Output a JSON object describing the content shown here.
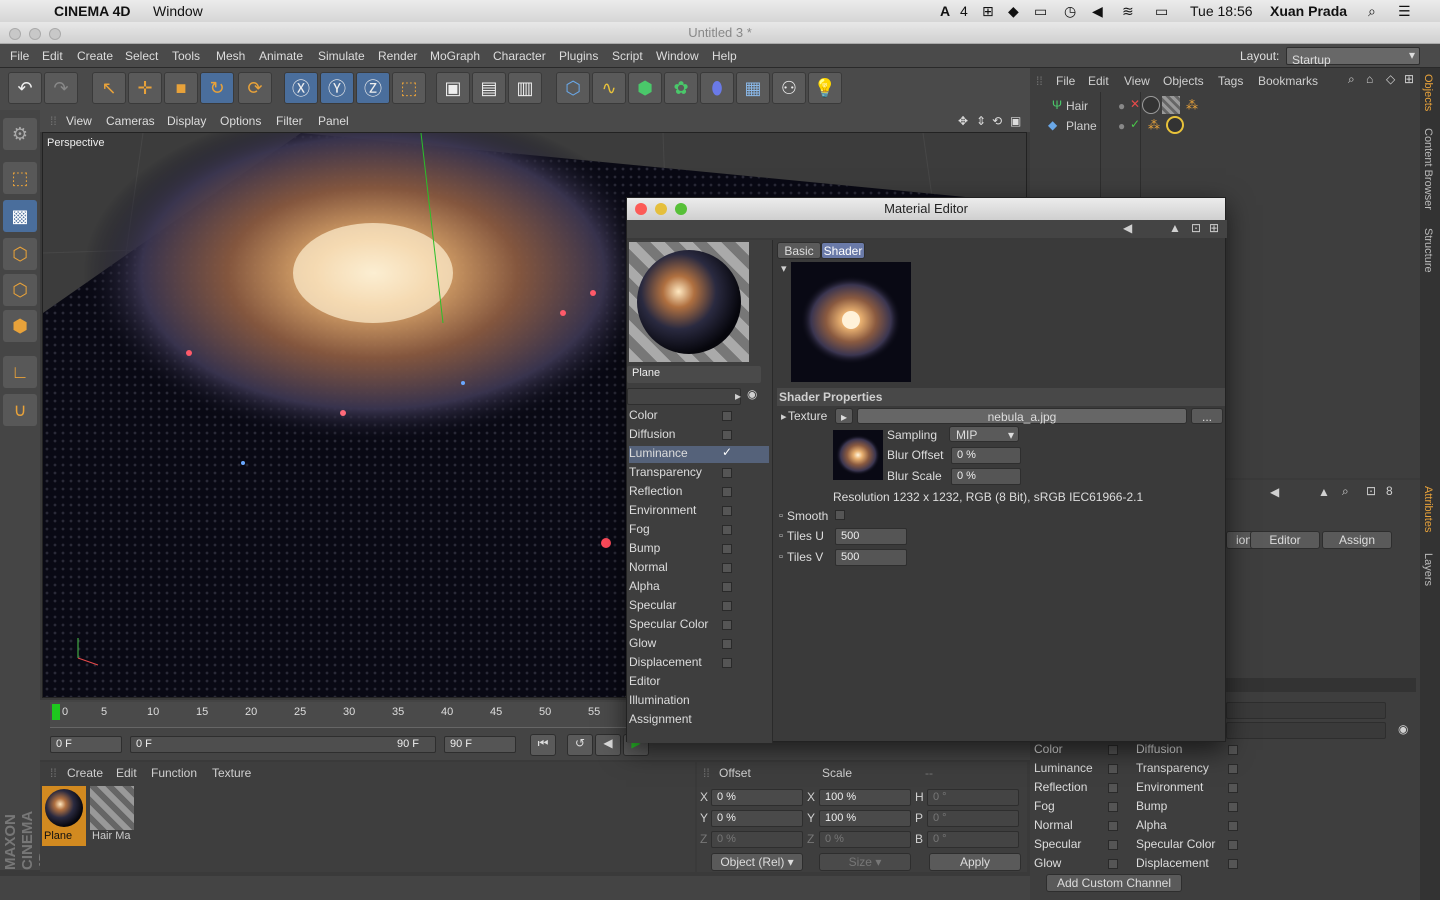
{
  "mac": {
    "app": "CINEMA 4D",
    "menu_window": "Window",
    "battery_num": "4",
    "clock": "Tue 18:56",
    "user": "Xuan Prada"
  },
  "window": {
    "title": "Untitled 3 *"
  },
  "menu": [
    "File",
    "Edit",
    "Create",
    "Select",
    "Tools",
    "Mesh",
    "Animate",
    "Simulate",
    "Render",
    "MoGraph",
    "Character",
    "Plugins",
    "Script",
    "Window",
    "Help"
  ],
  "layout": {
    "label": "Layout:",
    "value": "Startup"
  },
  "viewport": {
    "menu": [
      "View",
      "Cameras",
      "Display",
      "Options",
      "Filter",
      "Panel"
    ],
    "label": "Perspective"
  },
  "objects": {
    "menu": [
      "File",
      "Edit",
      "View",
      "Objects",
      "Tags",
      "Bookmarks"
    ],
    "items": [
      "Hair",
      "Plane"
    ]
  },
  "right_tabs": [
    "Objects",
    "Content Browser",
    "Structure",
    "Attributes",
    "Layers"
  ],
  "timeline": {
    "ticks": [
      "0",
      "5",
      "10",
      "15",
      "20",
      "25",
      "30",
      "35",
      "40",
      "45",
      "50",
      "55"
    ],
    "start": "0 F",
    "cur": "0 F",
    "end_slider": "90 F",
    "end": "90 F"
  },
  "matmgr": {
    "menu": [
      "Create",
      "Edit",
      "Function",
      "Texture"
    ],
    "materials": [
      "Plane",
      "Hair Ma"
    ],
    "brand": "MAXON CINEMA 4D"
  },
  "coords": {
    "headers": [
      "Offset",
      "Scale",
      "--"
    ],
    "rows": [
      {
        "a": "X",
        "av": "0 %",
        "b": "X",
        "bv": "100 %",
        "c": "H",
        "cv": "0 °"
      },
      {
        "a": "Y",
        "av": "0 %",
        "b": "Y",
        "bv": "100 %",
        "c": "P",
        "cv": "0 °"
      },
      {
        "a": "Z",
        "av": "0 %",
        "b": "Z",
        "bv": "0 %",
        "c": "B",
        "cv": "0 °"
      }
    ],
    "mode": "Object (Rel)",
    "size": "Size",
    "apply": "Apply"
  },
  "attributes": {
    "tabs": [
      "ion",
      "Editor",
      "Assign"
    ],
    "chan_left": [
      "Color",
      "Luminance",
      "Reflection",
      "Fog",
      "Normal",
      "Specular",
      "Glow"
    ],
    "chan_right": [
      "Diffusion",
      "Transparency",
      "Environment",
      "Bump",
      "Alpha",
      "Specular Color",
      "Displacement"
    ],
    "add": "Add Custom Channel"
  },
  "mated": {
    "title": "Material Editor",
    "mat_name": "Plane",
    "channels": [
      "Color",
      "Diffusion",
      "Luminance",
      "Transparency",
      "Reflection",
      "Environment",
      "Fog",
      "Bump",
      "Normal",
      "Alpha",
      "Specular",
      "Specular Color",
      "Glow",
      "Displacement",
      "Editor",
      "Illumination",
      "Assignment"
    ],
    "tabs": [
      "Basic",
      "Shader"
    ],
    "shader_props": "Shader Properties",
    "texture_label": "Texture",
    "texture_file": "nebula_a.jpg",
    "dots": "...",
    "sampling_label": "Sampling",
    "sampling": "MIP",
    "blur_offset_label": "Blur Offset",
    "blur_offset": "0 %",
    "blur_scale_label": "Blur Scale",
    "blur_scale": "0 %",
    "resolution": "Resolution 1232 x 1232, RGB (8 Bit), sRGB IEC61966-2.1",
    "smooth_label": "Smooth",
    "tilesu_label": "Tiles U",
    "tilesu": "500",
    "tilesv_label": "Tiles V",
    "tilesv": "500"
  }
}
